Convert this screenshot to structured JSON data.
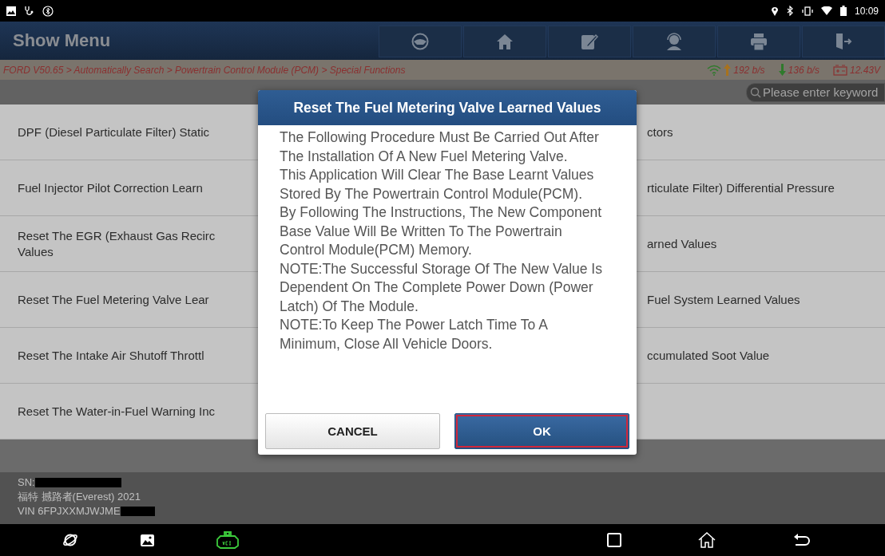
{
  "status_bar": {
    "time": "10:09"
  },
  "header": {
    "title": "Show Menu"
  },
  "breadcrumb": {
    "path": "FORD V50.65 > Automatically Search > Powertrain Control Module (PCM) > Special Functions",
    "upload": "192 b/s",
    "download": "136 b/s",
    "voltage": "12.43V"
  },
  "search": {
    "placeholder": "Please enter keyword"
  },
  "menu": [
    {
      "left": "DPF (Diesel Particulate Filter) Static",
      "right": "ctors"
    },
    {
      "left": "Fuel Injector Pilot Correction Learn",
      "right": "rticulate Filter) Differential Pressure"
    },
    {
      "left": "Reset The EGR (Exhaust Gas Recirc\nValues",
      "right": "arned Values"
    },
    {
      "left": "Reset The Fuel Metering Valve Lear",
      "right": "Fuel System Learned Values"
    },
    {
      "left": "Reset The Intake Air Shutoff Throttl",
      "right": "ccumulated Soot Value"
    },
    {
      "left": "Reset The Water-in-Fuel Warning Inc"
    }
  ],
  "dialog": {
    "title": "Reset The Fuel Metering Valve Learned Values",
    "paragraphs": [
      "The Following Procedure Must Be Carried Out After The Installation Of A New Fuel Metering Valve.",
      "This Application Will Clear The Base Learnt Values Stored By The Powertrain Control Module(PCM).",
      "By Following The Instructions, The New Component Base Value Will Be Written To The Powertrain Control Module(PCM) Memory.",
      "NOTE:The Successful Storage Of The New Value Is Dependent On The Complete Power Down (Power Latch) Of The Module.",
      "NOTE:To Keep The Power Latch Time To A Minimum, Close All Vehicle Doors."
    ],
    "buttons": [
      {
        "label": "CANCEL",
        "kind": "secondary",
        "selected": false
      },
      {
        "label": "OK",
        "kind": "primary",
        "selected": true
      }
    ]
  },
  "footer": {
    "sn_label": "SN:",
    "vehicle": "福特 撼路者(Everest) 2021",
    "vin": "VIN 6FPJXXMJWJME"
  }
}
